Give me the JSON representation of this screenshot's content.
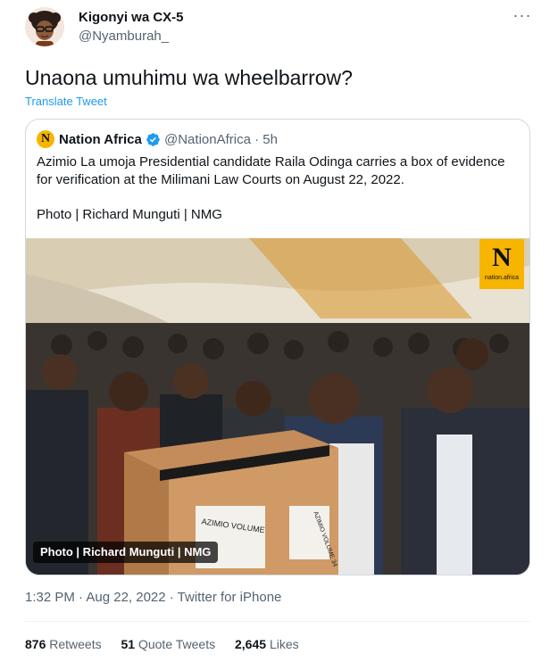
{
  "author": {
    "display_name": "Kigonyi wa CX-5",
    "handle": "@Nyamburah_"
  },
  "tweet": {
    "text": "Unaona umuhimu wa wheelbarrow?",
    "translate_label": "Translate Tweet",
    "more_label": "···"
  },
  "quote": {
    "logo_letter": "N",
    "name": "Nation Africa",
    "handle_time": "@NationAfrica · 5h",
    "text": "Azimio La umoja Presidential candidate Raila Odinga carries a box of evidence for verification at the Milimani Law Courts on August 22, 2022.",
    "credit": "Photo | Richard Munguti | NMG",
    "photo": {
      "watermark_letter": "N",
      "watermark_text": "nation.africa",
      "badge": "Photo | Richard Munguti | NMG",
      "box_label_1": "AZIMIO VOLUME",
      "box_label_2": "AZIMIO VOLUME 34"
    }
  },
  "meta": {
    "timestamp": "1:32 PM · Aug 22, 2022 · Twitter for iPhone"
  },
  "stats": {
    "retweets_count": "876",
    "retweets_label": "Retweets",
    "quotes_count": "51",
    "quotes_label": "Quote Tweets",
    "likes_count": "2,645",
    "likes_label": "Likes"
  },
  "colors": {
    "link": "#1d9bf0",
    "secondary_text": "#536471",
    "border": "#cfd9de",
    "nation_brand": "#f7b500"
  }
}
